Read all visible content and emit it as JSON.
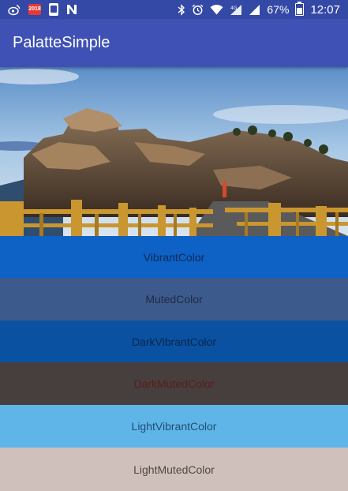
{
  "status_bar": {
    "icons_left": [
      "weibo-icon",
      "calendar-icon",
      "phone-icon",
      "n-icon"
    ],
    "calendar_text": "2018",
    "icons_right": [
      "bluetooth-icon",
      "alarm-icon",
      "wifi-icon",
      "signal-4g-icon",
      "signal-icon"
    ],
    "battery_percent": "67%",
    "time": "12:07"
  },
  "app_bar": {
    "title": "PalatteSimple",
    "color": "#3f51b5"
  },
  "image": {
    "description_icon": "landscape-photo"
  },
  "swatches": [
    {
      "label": "VibrantColor",
      "bg": "#0e61c5",
      "fg": "#0b2c55"
    },
    {
      "label": "MutedColor",
      "bg": "#3d5a8c",
      "fg": "#1d2b44"
    },
    {
      "label": "DarkVibrantColor",
      "bg": "#0a51a1",
      "fg": "#07264d"
    },
    {
      "label": "DarkMutedColor",
      "bg": "#463f3d",
      "fg": "#5a1e1e"
    },
    {
      "label": "LightVibrantColor",
      "bg": "#60b5e8",
      "fg": "#1e4d72"
    },
    {
      "label": "LightMutedColor",
      "bg": "#d0c0bb",
      "fg": "#4d4745"
    }
  ]
}
